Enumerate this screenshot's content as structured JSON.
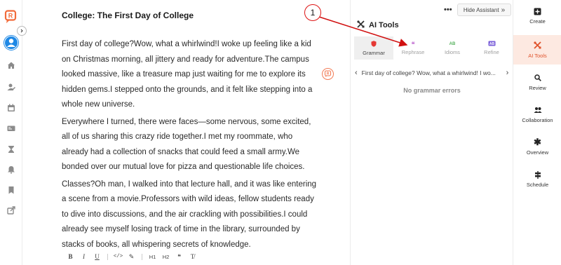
{
  "document": {
    "title": "College: The First Day of College",
    "paragraphs": [
      "First day of college?Wow, what a whirlwind!I woke up feeling like a kid on Christmas morning, all jittery and ready for adventure.The campus looked massive, like a treasure map just waiting for me to explore its hidden gems.I stepped onto the grounds, and it felt like stepping into a whole new universe.",
      "Everywhere I turned, there were faces—some nervous, some excited, all of us sharing this crazy ride together.I met my roommate, who already had a collection of snacks that could feed a small army.We bonded over our mutual love for pizza and questionable life choices.",
      "Classes?Oh man, I walked into that lecture hall, and it was like entering a scene from a movie.Professors with wild ideas, fellow students ready to dive into discussions, and the air crackling with possibilities.I could already see myself losing track of time in the library, surrounded by stacks of books, all whispering secrets of knowledge."
    ]
  },
  "toolbar": {
    "bold": "B",
    "italic": "I",
    "underline": "U",
    "code": "</>",
    "highlight": "✎",
    "h1": "H1",
    "h2": "H2",
    "quote": "❝",
    "clear": "T̸"
  },
  "assistant": {
    "more": "•••",
    "hide_label": "Hide Assistant",
    "hide_chevron": "»",
    "title": "AI Tools",
    "tools": [
      {
        "label": "Grammar",
        "icon": "shield-icon",
        "color": "#e53935"
      },
      {
        "label": "Rephrase",
        "icon": "quote-icon",
        "color": "#c77dd6"
      },
      {
        "label": "Idioms",
        "icon": "ab-icon",
        "color": "#55b15c"
      },
      {
        "label": "Refine",
        "icon": "ab-box-icon",
        "color": "#7a5fd9"
      }
    ],
    "snippet_prev": "‹",
    "snippet": "First day of college? Wow, what a whirlwind! I wo...",
    "snippet_next": "›",
    "status": "No grammar errors"
  },
  "right_nav": [
    {
      "label": "Create",
      "icon": "plus-square-icon"
    },
    {
      "label": "AI Tools",
      "icon": "tools-icon",
      "active": true
    },
    {
      "label": "Review",
      "icon": "search-icon"
    },
    {
      "label": "Collaboration",
      "icon": "people-icon"
    },
    {
      "label": "Overview",
      "icon": "asterisk-icon"
    },
    {
      "label": "Schedule",
      "icon": "signpost-icon"
    }
  ],
  "annotation": {
    "number": "1"
  },
  "colors": {
    "accent": "#e0532c",
    "accent_bg": "#fde9e1",
    "annotation": "#d11111"
  }
}
